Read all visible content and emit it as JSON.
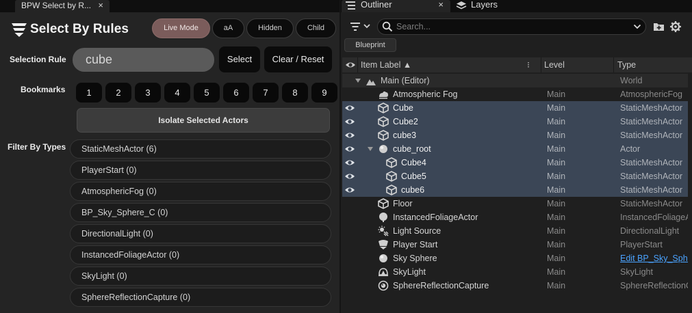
{
  "left": {
    "tab": {
      "title": "BPW Select by R...",
      "close": "×"
    },
    "title": "Select By Rules",
    "toggles": [
      {
        "label": "Live Mode",
        "active": true
      },
      {
        "label": "aA",
        "active": false
      },
      {
        "label": "Hidden",
        "active": false
      },
      {
        "label": "Child",
        "active": false
      }
    ],
    "selection_rule_label": "Selection Rule",
    "rule_value": "cube",
    "select_label": "Select",
    "clear_label": "Clear / Reset",
    "bookmarks_label": "Bookmarks",
    "bookmarks": [
      "1",
      "2",
      "3",
      "4",
      "5",
      "6",
      "7",
      "8",
      "9"
    ],
    "isolate_label": "Isolate Selected Actors",
    "filter_label": "Filter By Types",
    "types": [
      "StaticMeshActor  (6)",
      "PlayerStart  (0)",
      "AtmosphericFog  (0)",
      "BP_Sky_Sphere_C  (0)",
      "DirectionalLight  (0)",
      "InstancedFoliageActor  (0)",
      "SkyLight  (0)",
      "SphereReflectionCapture  (0)"
    ]
  },
  "right": {
    "tabs": [
      {
        "title": "Outliner",
        "icon": "outliner-icon",
        "close": "×"
      },
      {
        "title": "Layers",
        "icon": "layers-icon"
      }
    ],
    "search_placeholder": "Search...",
    "blueprint_label": "Blueprint",
    "columns": {
      "item": "Item Label ▲",
      "level": "Level",
      "type": "Type"
    },
    "rows": [
      {
        "name": "Main (Editor)",
        "level": "",
        "type": "World",
        "icon": "world-icon",
        "indent": 0,
        "arrow": true,
        "eye": false,
        "selected": false,
        "world": true
      },
      {
        "name": "Atmospheric Fog",
        "level": "Main",
        "type": "AtmosphericFog",
        "icon": "fog-icon",
        "indent": 1,
        "arrow": false,
        "eye": false,
        "selected": false
      },
      {
        "name": "Cube",
        "level": "Main",
        "type": "StaticMeshActor",
        "icon": "mesh-icon",
        "indent": 1,
        "arrow": false,
        "eye": true,
        "selected": true
      },
      {
        "name": "Cube2",
        "level": "Main",
        "type": "StaticMeshActor",
        "icon": "mesh-icon",
        "indent": 1,
        "arrow": false,
        "eye": true,
        "selected": true
      },
      {
        "name": "cube3",
        "level": "Main",
        "type": "StaticMeshActor",
        "icon": "mesh-icon",
        "indent": 1,
        "arrow": false,
        "eye": true,
        "selected": true
      },
      {
        "name": "cube_root",
        "level": "Main",
        "type": "Actor",
        "icon": "actor-icon",
        "indent": 1,
        "arrow": true,
        "eye": true,
        "selected": true
      },
      {
        "name": "Cube4",
        "level": "Main",
        "type": "StaticMeshActor",
        "icon": "mesh-icon",
        "indent": 2,
        "arrow": false,
        "eye": true,
        "selected": true
      },
      {
        "name": "Cube5",
        "level": "Main",
        "type": "StaticMeshActor",
        "icon": "mesh-icon",
        "indent": 2,
        "arrow": false,
        "eye": true,
        "selected": true
      },
      {
        "name": "cube6",
        "level": "Main",
        "type": "StaticMeshActor",
        "icon": "mesh-icon",
        "indent": 2,
        "arrow": false,
        "eye": true,
        "selected": true
      },
      {
        "name": "Floor",
        "level": "Main",
        "type": "StaticMeshActor",
        "icon": "mesh-icon",
        "indent": 1,
        "arrow": false,
        "eye": false,
        "selected": false
      },
      {
        "name": "InstancedFoliageActor",
        "level": "Main",
        "type": "InstancedFoliageActor",
        "icon": "foliage-icon",
        "indent": 1,
        "arrow": false,
        "eye": false,
        "selected": false
      },
      {
        "name": "Light Source",
        "level": "Main",
        "type": "DirectionalLight",
        "icon": "light-icon",
        "indent": 1,
        "arrow": false,
        "eye": false,
        "selected": false
      },
      {
        "name": "Player Start",
        "level": "Main",
        "type": "PlayerStart",
        "icon": "player-start-icon",
        "indent": 1,
        "arrow": false,
        "eye": false,
        "selected": false
      },
      {
        "name": "Sky Sphere",
        "level": "Main",
        "type": "Edit BP_Sky_Sphere",
        "icon": "actor-icon",
        "indent": 1,
        "arrow": false,
        "eye": false,
        "selected": false,
        "link": true
      },
      {
        "name": "SkyLight",
        "level": "Main",
        "type": "SkyLight",
        "icon": "skylight-icon",
        "indent": 1,
        "arrow": false,
        "eye": false,
        "selected": false
      },
      {
        "name": "SphereReflectionCapture",
        "level": "Main",
        "type": "SphereReflectionCapture",
        "icon": "reflection-capture-icon",
        "indent": 1,
        "arrow": false,
        "eye": false,
        "selected": false
      }
    ]
  },
  "colors": {
    "selected_row": "#3b4656",
    "live_mode_active": "#7b5c5b",
    "link": "#4aa3ff"
  }
}
